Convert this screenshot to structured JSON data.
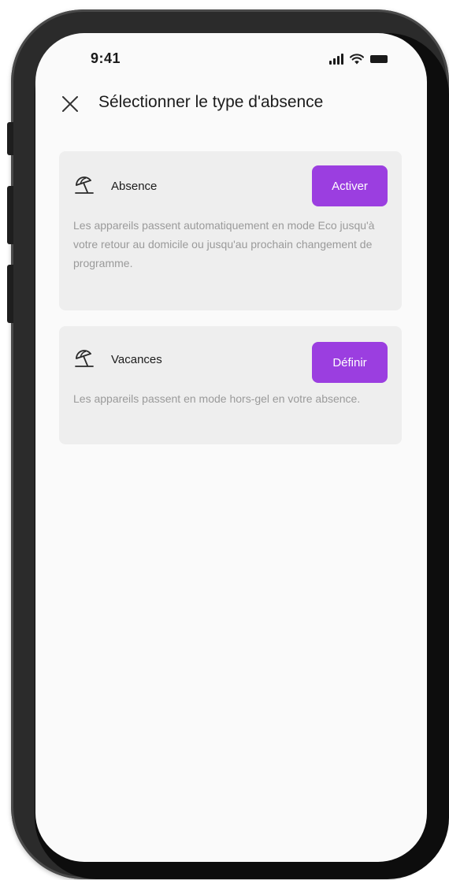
{
  "status_bar": {
    "time": "9:41"
  },
  "header": {
    "close_icon": "close-icon",
    "title": "Sélectionner le type d'absence"
  },
  "cards": [
    {
      "icon": "beach-umbrella-icon",
      "title": "Absence",
      "button_label": "Activer",
      "description": "Les appareils passent automatiquement en mode Eco jusqu'à votre retour au domicile ou jusqu'au prochain changement de programme."
    },
    {
      "icon": "beach-umbrella-icon",
      "title": "Vacances",
      "button_label": "Définir",
      "description": "Les appareils passent en mode hors-gel en votre absence."
    }
  ],
  "colors": {
    "accent": "#9b3ee0",
    "card_background": "#eeeeee",
    "screen_background": "#fafafa",
    "description_text": "#9a9a9a"
  }
}
